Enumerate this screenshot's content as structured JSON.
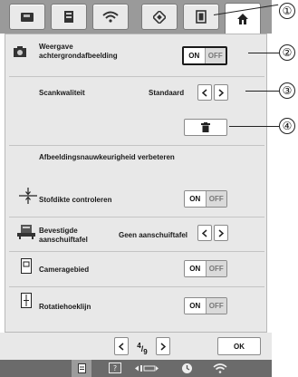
{
  "tabs": [
    {
      "icon": "sewing-machine-icon"
    },
    {
      "icon": "embroidery-machine-icon"
    },
    {
      "icon": "wireless-icon"
    },
    {
      "icon": "embroidery-frame-icon"
    },
    {
      "icon": "hoop-icon"
    },
    {
      "icon": "home-icon",
      "active": true
    }
  ],
  "settings": {
    "background_image": {
      "label": "Weergave achtergrondafbeelding",
      "on": "ON",
      "off": "OFF",
      "selected": "ON"
    },
    "scan_quality": {
      "label": "Scankwaliteit",
      "value": "Standaard"
    },
    "improve_accuracy": {
      "label": "Afbeeldingsnauwkeurigheid verbeteren"
    },
    "fabric_thickness": {
      "label": "Stofdikte controleren",
      "on": "ON",
      "off": "OFF"
    },
    "fixed_table": {
      "label": "Bevestigde aanschuiftafel",
      "value": "Geen aanschuiftafel"
    },
    "camera_area": {
      "label": "Cameragebied",
      "on": "ON",
      "off": "OFF"
    },
    "rotation_line": {
      "label": "Rotatiehoeklijn",
      "on": "ON",
      "off": "OFF"
    }
  },
  "pager": {
    "current": "4",
    "total": "9",
    "ok": "OK"
  },
  "callouts": [
    "①",
    "②",
    "③",
    "④"
  ],
  "colors": {
    "tab_bar": "#9a9a9a",
    "panel": "#e8e8e8",
    "status_bar": "#6b6b6b"
  }
}
